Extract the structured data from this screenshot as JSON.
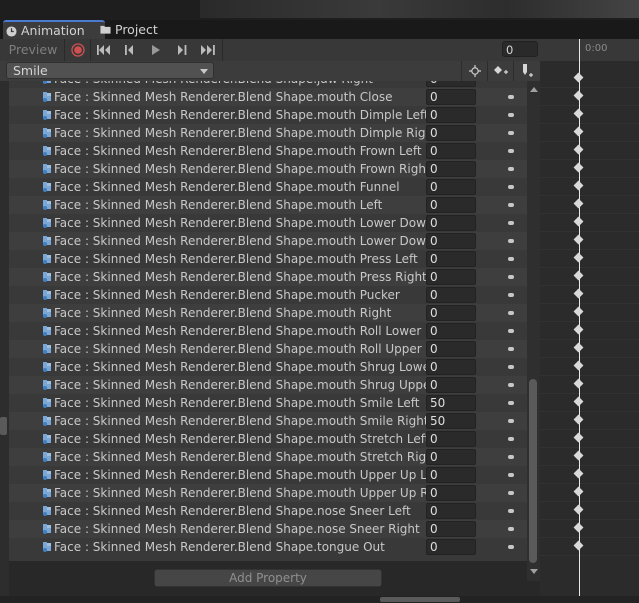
{
  "tabs": [
    {
      "label": "Animation",
      "icon": "clock-icon",
      "active": true
    },
    {
      "label": "Project",
      "icon": "folder-icon",
      "active": false
    }
  ],
  "toolbar": {
    "preview_label": "Preview",
    "frame_value": "0",
    "buttons": [
      "record-icon",
      "first-key-icon",
      "prev-key-icon",
      "play-icon",
      "next-key-icon",
      "last-key-icon"
    ]
  },
  "timeline": {
    "ruler_label": "0:00"
  },
  "clip": {
    "name": "Smile"
  },
  "properties": [
    {
      "label": "Face : Skinned Mesh Renderer.Blend Shape.jaw Right",
      "value": "0"
    },
    {
      "label": "Face : Skinned Mesh Renderer.Blend Shape.mouth Close",
      "value": "0"
    },
    {
      "label": "Face : Skinned Mesh Renderer.Blend Shape.mouth Dimple Left",
      "value": "0"
    },
    {
      "label": "Face : Skinned Mesh Renderer.Blend Shape.mouth Dimple Right",
      "value": "0"
    },
    {
      "label": "Face : Skinned Mesh Renderer.Blend Shape.mouth Frown Left",
      "value": "0"
    },
    {
      "label": "Face : Skinned Mesh Renderer.Blend Shape.mouth Frown Right",
      "value": "0"
    },
    {
      "label": "Face : Skinned Mesh Renderer.Blend Shape.mouth Funnel",
      "value": "0"
    },
    {
      "label": "Face : Skinned Mesh Renderer.Blend Shape.mouth Left",
      "value": "0"
    },
    {
      "label": "Face : Skinned Mesh Renderer.Blend Shape.mouth Lower Down Le",
      "value": "0"
    },
    {
      "label": "Face : Skinned Mesh Renderer.Blend Shape.mouth Lower Down Ri",
      "value": "0"
    },
    {
      "label": "Face : Skinned Mesh Renderer.Blend Shape.mouth Press Left",
      "value": "0"
    },
    {
      "label": "Face : Skinned Mesh Renderer.Blend Shape.mouth Press Right",
      "value": "0"
    },
    {
      "label": "Face : Skinned Mesh Renderer.Blend Shape.mouth Pucker",
      "value": "0"
    },
    {
      "label": "Face : Skinned Mesh Renderer.Blend Shape.mouth Right",
      "value": "0"
    },
    {
      "label": "Face : Skinned Mesh Renderer.Blend Shape.mouth Roll Lower",
      "value": "0"
    },
    {
      "label": "Face : Skinned Mesh Renderer.Blend Shape.mouth Roll Upper",
      "value": "0"
    },
    {
      "label": "Face : Skinned Mesh Renderer.Blend Shape.mouth Shrug Lower",
      "value": "0"
    },
    {
      "label": "Face : Skinned Mesh Renderer.Blend Shape.mouth Shrug Upper",
      "value": "0"
    },
    {
      "label": "Face : Skinned Mesh Renderer.Blend Shape.mouth Smile Left",
      "value": "50"
    },
    {
      "label": "Face : Skinned Mesh Renderer.Blend Shape.mouth Smile Right",
      "value": "50"
    },
    {
      "label": "Face : Skinned Mesh Renderer.Blend Shape.mouth Stretch Left",
      "value": "0"
    },
    {
      "label": "Face : Skinned Mesh Renderer.Blend Shape.mouth Stretch Right",
      "value": "0"
    },
    {
      "label": "Face : Skinned Mesh Renderer.Blend Shape.mouth Upper Up Left",
      "value": "0"
    },
    {
      "label": "Face : Skinned Mesh Renderer.Blend Shape.mouth Upper Up Right",
      "value": "0"
    },
    {
      "label": "Face : Skinned Mesh Renderer.Blend Shape.nose Sneer Left",
      "value": "0"
    },
    {
      "label": "Face : Skinned Mesh Renderer.Blend Shape.nose Sneer Right",
      "value": "0"
    },
    {
      "label": "Face : Skinned Mesh Renderer.Blend Shape.tongue Out",
      "value": "0"
    }
  ],
  "add_property_label": "Add Property",
  "colors": {
    "accent_tab": "#4a7bd0",
    "record": "#d05050",
    "keyframe": "#d9d9d9"
  }
}
